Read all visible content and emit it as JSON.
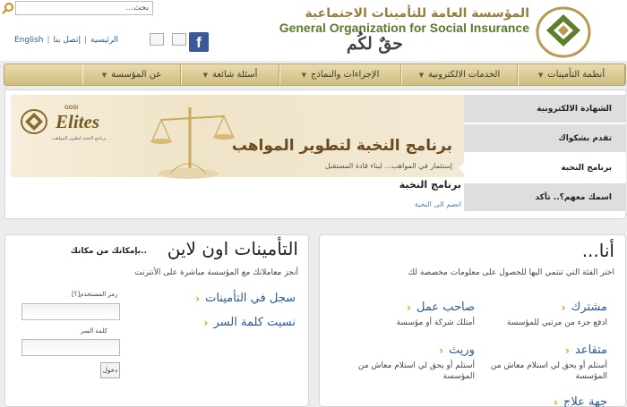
{
  "header": {
    "search_placeholder": "بحث...",
    "util_links": [
      "English",
      "الرئيسية",
      "إتصل بنا"
    ],
    "org_name_ar": "المؤسسة العامة للتأمينات الاجتماعية",
    "org_name_en": "General Organization for Social Insurance",
    "slogan": "حقٌ لكُم"
  },
  "nav": {
    "items": [
      {
        "label": "أنظمة التأمينات",
        "width": 120
      },
      {
        "label": "الخدمات الالكترونية",
        "width": 130
      },
      {
        "label": "الإجراءات والنماذج",
        "width": 136
      },
      {
        "label": "أسئلة شائعة",
        "width": 110
      },
      {
        "label": "عن المؤسسة",
        "width": 110
      }
    ]
  },
  "banner": {
    "brand_small": "GOSI",
    "brand": "Elites",
    "brand_tagline": "برنامج النخبة لتطوير المواهب",
    "headline": "برنامج النخبة لتطوير المواهب",
    "subline": "إستثمار في المواهب... لبناء قادة المستقبل",
    "panel_title": "برنامج النخبة",
    "panel_link": "انضم الى النخبة"
  },
  "side_tabs": [
    {
      "label": "الشهادة الالكترونية",
      "active": false
    },
    {
      "label": "تقدم بشكواك",
      "active": false
    },
    {
      "label": "برنامج النخبة",
      "active": true
    },
    {
      "label": "اسمك معهم؟.. تأكد",
      "active": false
    }
  ],
  "online": {
    "title": "التأمينات اون لاين",
    "tagline": "..بإمكانك من مكانك",
    "description": "أنجز معاملاتك مع المؤسسة مباشرة على الأنترنت",
    "links": [
      "سجل في التأمينات",
      "نسيت كلمة السر"
    ],
    "username_label": "رمز المستخدم[؟]",
    "password_label": "كلمة السر",
    "login_button": "دخول"
  },
  "iam": {
    "title": "أنا...",
    "description": "اختر الفئة التي تنتمي اليها للحصول على معلومات مخصصة لك",
    "categories": [
      {
        "title": "مشترك",
        "desc": "ادفع جزء من مرتبي للمؤسسة"
      },
      {
        "title": "صاحب عمل",
        "desc": "أمتلك شركة أو مؤسسة"
      },
      {
        "title": "متقاعد",
        "desc": "أستلم أو يحق لي استلام معاش من المؤسسة"
      },
      {
        "title": "وريث",
        "desc": "أستلم أو يحق لي استلام معاش من المؤسسة"
      },
      {
        "title": "جهة علاج",
        "desc": ""
      }
    ]
  },
  "colors": {
    "gold": "#cfbc7f",
    "brand_green": "#5b7a2c",
    "brand_gold": "#9b7c3c",
    "link": "#2a5a9a",
    "accent_orange": "#e89a20"
  }
}
